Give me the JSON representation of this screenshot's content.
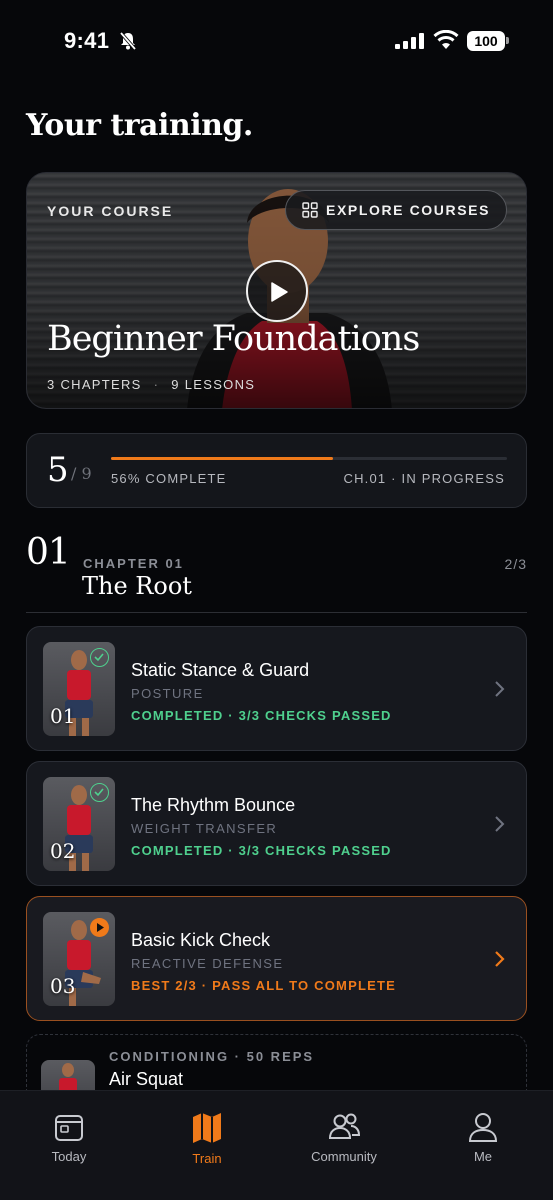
{
  "status_bar": {
    "time": "9:41",
    "battery": "100"
  },
  "page_title": "Your training.",
  "hero": {
    "label": "YOUR COURSE",
    "explore_label": "EXPLORE COURSES",
    "title": "Beginner Foundations",
    "chapters": "3 CHAPTERS",
    "lessons": "9 LESSONS"
  },
  "progress": {
    "completed": "5",
    "total": "/ 9",
    "fraction": 0.56,
    "percent_label": "56% COMPLETE",
    "status": "CH.01 · IN PROGRESS"
  },
  "chapter": {
    "number": "01",
    "label": "CHAPTER 01",
    "title": "The Root",
    "count": "2/3"
  },
  "lessons": [
    {
      "num": "01",
      "title": "Static Stance & Guard",
      "subtitle": "POSTURE",
      "status": "COMPLETED · 3/3 CHECKS PASSED",
      "state": "completed"
    },
    {
      "num": "02",
      "title": "The Rhythm Bounce",
      "subtitle": "WEIGHT TRANSFER",
      "status": "COMPLETED · 3/3 CHECKS PASSED",
      "state": "completed"
    },
    {
      "num": "03",
      "title": "Basic Kick Check",
      "subtitle": "REACTIVE DEFENSE",
      "status": "BEST 2/3 · PASS ALL TO COMPLETE",
      "state": "in-progress"
    }
  ],
  "extra": {
    "label": "CONDITIONING · 50 REPS",
    "title": "Air Squat"
  },
  "tabs": [
    {
      "label": "Today",
      "icon": "calendar-icon"
    },
    {
      "label": "Train",
      "icon": "map-icon",
      "active": true
    },
    {
      "label": "Community",
      "icon": "people-icon"
    },
    {
      "label": "Me",
      "icon": "person-icon"
    }
  ],
  "colors": {
    "accent": "#f07a1a",
    "success": "#4fd08e",
    "background": "#06070a"
  }
}
